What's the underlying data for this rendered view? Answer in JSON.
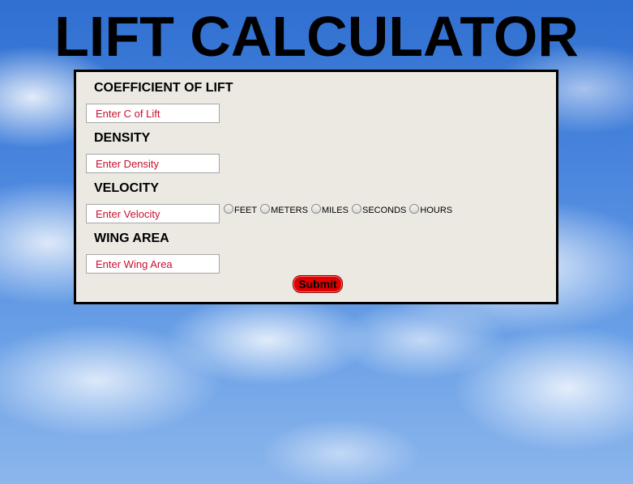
{
  "page": {
    "title": "LIFT CALCULATOR"
  },
  "form": {
    "coefficient": {
      "label": "COEFFICIENT OF LIFT",
      "placeholder": "Enter C of Lift",
      "value": ""
    },
    "density": {
      "label": "DENSITY",
      "placeholder": "Enter Density",
      "value": ""
    },
    "velocity": {
      "label": "VELOCITY",
      "placeholder": "Enter Velocity",
      "value": "",
      "units": [
        "FEET",
        "METERS",
        "MILES",
        "SECONDS",
        "HOURS"
      ]
    },
    "wing_area": {
      "label": "WING AREA",
      "placeholder": "Enter Wing Area",
      "value": ""
    },
    "submit_label": "Submit"
  },
  "colors": {
    "panel_background": "#ebe9e1",
    "placeholder_text": "#c8102e",
    "submit_background": "#e00000"
  }
}
